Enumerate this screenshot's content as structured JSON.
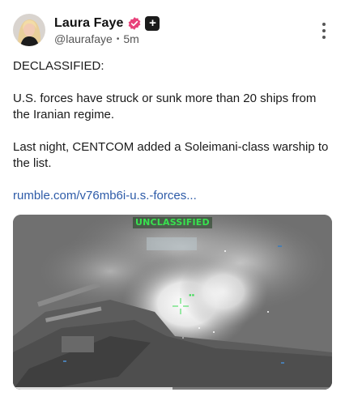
{
  "post": {
    "author": {
      "display_name": "Laura Faye",
      "handle": "@laurafaye",
      "time_ago": "5m",
      "verified_icon": "verified-check-icon",
      "badge_icon": "plus-badge-icon",
      "badge_glyph": "+"
    },
    "body": {
      "paragraphs": [
        "DECLASSIFIED:",
        "U.S. forces have struck or sunk more than 20 ships from the Iranian regime.",
        "Last night, CENTCOM added a Soleimani-class warship to the list."
      ],
      "link_text": "rumble.com/v76mb6i-u.s.-forces..."
    },
    "media": {
      "classification_label": "UNCLASSIFIED",
      "playback_progress": 0.5
    }
  },
  "colors": {
    "verified": "#e8417a",
    "link": "#2d5ba8",
    "overlay_green": "#38e34f"
  }
}
